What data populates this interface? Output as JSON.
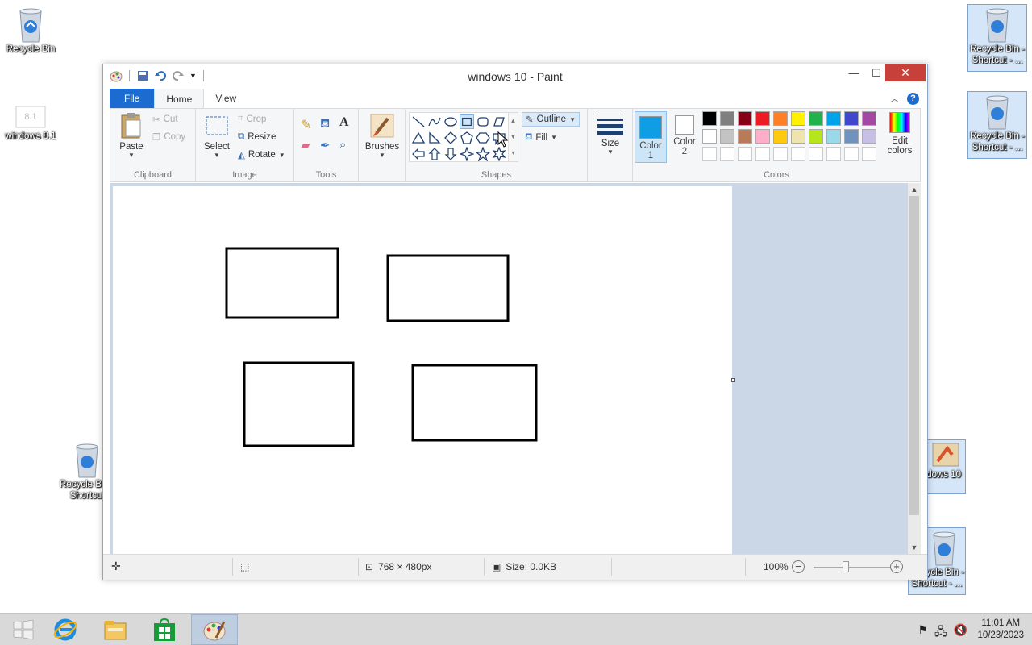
{
  "desktop": {
    "icons": [
      {
        "label": "Recycle Bin"
      },
      {
        "label": "windows 8.1"
      },
      {
        "label": "Recycle Bin - Shortcut - ..."
      },
      {
        "label": "Recycle Bin - Shortcut - ..."
      },
      {
        "label": "Recycle Bin - Shortcut"
      },
      {
        "label": "windows 10"
      },
      {
        "label": "Recycle Bin - Shortcut - ..."
      }
    ]
  },
  "window": {
    "title": "windows 10 - Paint",
    "controls": {
      "minimize": "—",
      "maximize": "☐",
      "close": "✕"
    }
  },
  "tabs": [
    {
      "label": "File"
    },
    {
      "label": "Home"
    },
    {
      "label": "View"
    }
  ],
  "ribbon": {
    "clipboard": {
      "group_label": "Clipboard",
      "paste": "Paste",
      "cut": "Cut",
      "copy": "Copy"
    },
    "image": {
      "group_label": "Image",
      "select": "Select",
      "crop": "Crop",
      "resize": "Resize",
      "rotate": "Rotate"
    },
    "tools": {
      "group_label": "Tools"
    },
    "brushes": {
      "label": "Brushes"
    },
    "shapes": {
      "group_label": "Shapes",
      "outline": "Outline",
      "fill": "Fill"
    },
    "size": {
      "label": "Size"
    },
    "colors": {
      "group_label": "Colors",
      "color1_label": "Color",
      "color1_num": "1",
      "color2_label": "Color",
      "color2_num": "2",
      "color1_value": "#0f9ee6",
      "color2_value": "#ffffff",
      "edit_label": "Edit",
      "edit_label2": "colors",
      "palette_row1": [
        "#000000",
        "#7f7f7f",
        "#880015",
        "#ed1c24",
        "#ff7f27",
        "#fff200",
        "#22b14c",
        "#00a2e8",
        "#3f48cc",
        "#a349a4"
      ],
      "palette_row2": [
        "#ffffff",
        "#c3c3c3",
        "#b97a57",
        "#ffaec9",
        "#ffc90e",
        "#efe4b0",
        "#b5e61d",
        "#99d9ea",
        "#7092be",
        "#c8bfe7"
      ]
    }
  },
  "canvas": {
    "rectangles_count": 4
  },
  "statusbar": {
    "dimensions": "768 × 480px",
    "size": "Size: 0.0KB",
    "zoom": "100%"
  },
  "taskbar": {
    "time": "11:01 AM",
    "date": "10/23/2023"
  }
}
